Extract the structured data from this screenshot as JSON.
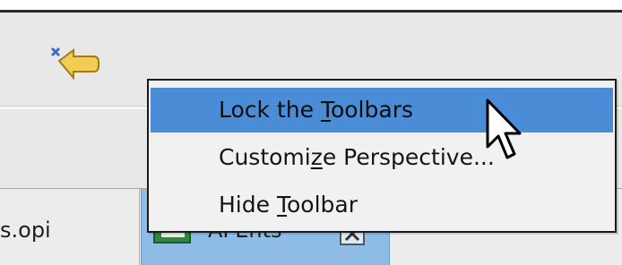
{
  "toolbar": {
    "back_button_icon": "back-arrow-icon"
  },
  "tabs": [
    {
      "label": "s.opi",
      "active": false
    },
    {
      "label": "AFEnts",
      "active": true,
      "icon": "opi-display-icon",
      "close_icon": "close-icon"
    }
  ],
  "context_menu": {
    "items": [
      {
        "before": "Lock the ",
        "mnemonic": "T",
        "after": "oolbars",
        "selected": true
      },
      {
        "before": "Customi",
        "mnemonic": "z",
        "after": "e Perspective...",
        "selected": false
      },
      {
        "before": "Hide ",
        "mnemonic": "T",
        "after": "oolbar",
        "selected": false
      }
    ]
  },
  "colors": {
    "selection": "#4a8cd6",
    "active_tab": "#8fbce6",
    "menu_bg": "#f1f1f1"
  }
}
